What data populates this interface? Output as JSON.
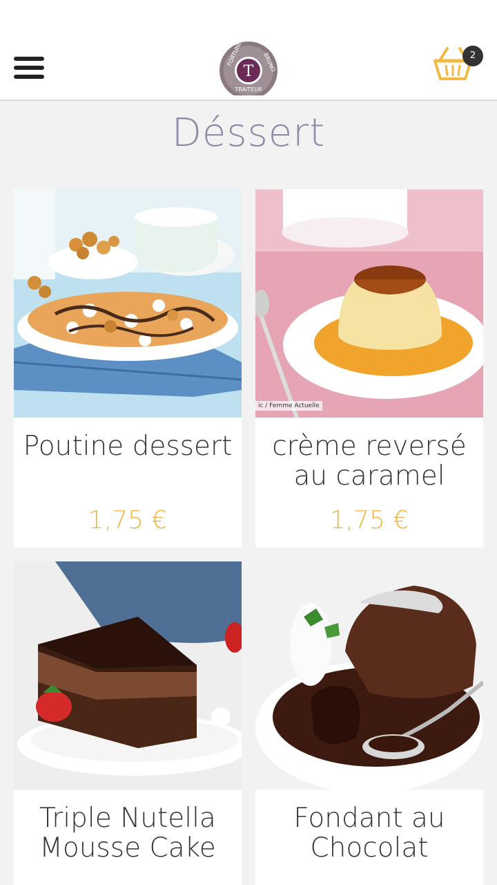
{
  "header": {
    "menu_icon": "hamburger-menu-icon",
    "logo_text_top": "FORTUNE BRUNO",
    "logo_text_bottom": "TRAITEUR",
    "logo_letter": "T",
    "cart_icon": "basket-icon",
    "cart_count": "2"
  },
  "page": {
    "title": "Déssert"
  },
  "products": [
    {
      "name": "Poutine dessert",
      "price": "1,75 €",
      "image": "poutine-dessert-photo"
    },
    {
      "name": "crème reversé au caramel",
      "price": "1,75 €",
      "image": "creme-caramel-photo",
      "image_credit": "ic / Femme Actuelle"
    },
    {
      "name": "Triple Nutella Mousse Cake",
      "image": "nutella-mousse-cake-photo"
    },
    {
      "name": "Fondant au Chocolat",
      "image": "fondant-chocolat-photo"
    }
  ],
  "colors": {
    "accent_price": "#f0b64a",
    "title": "#8c8ca4",
    "logo_purple": "#6b2b55",
    "basket": "#f4b942"
  }
}
